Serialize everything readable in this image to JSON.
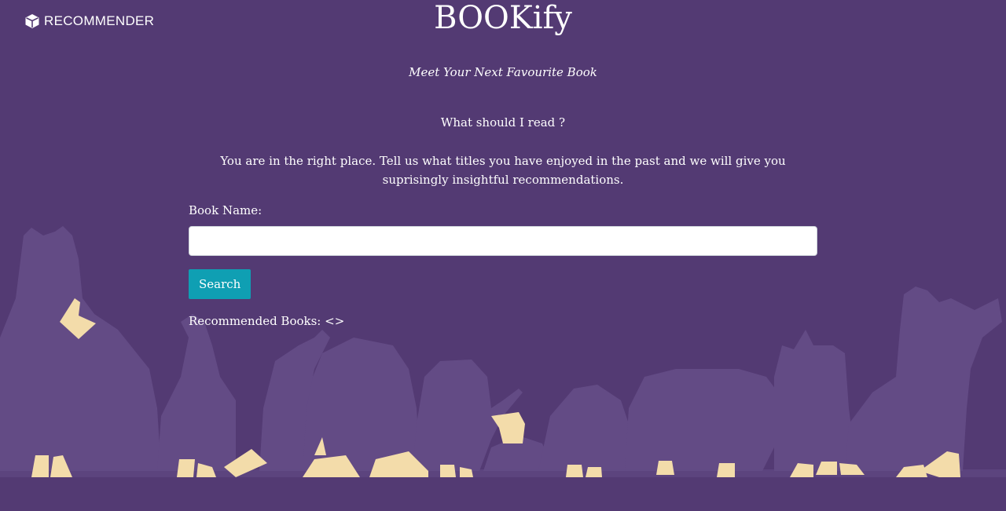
{
  "nav": {
    "brand_icon": "cube-icon",
    "brand_label": "RECOMMENDER"
  },
  "header": {
    "title": "BOOKify",
    "tagline": "Meet Your Next Favourite Book"
  },
  "intro": {
    "question": "What should I read ?",
    "description": "You are in the right place. Tell us what titles you have enjoyed in the past and we will give you suprisingly insightful recommendations."
  },
  "form": {
    "book_label": "Book Name:",
    "book_value": "",
    "book_placeholder": "",
    "search_label": "Search"
  },
  "results": {
    "label": "Recommended Books: <>"
  },
  "colors": {
    "background": "#533a73",
    "silhouette": "#634b85",
    "feet": "#f3dcaa",
    "button": "#0f9fb3"
  }
}
